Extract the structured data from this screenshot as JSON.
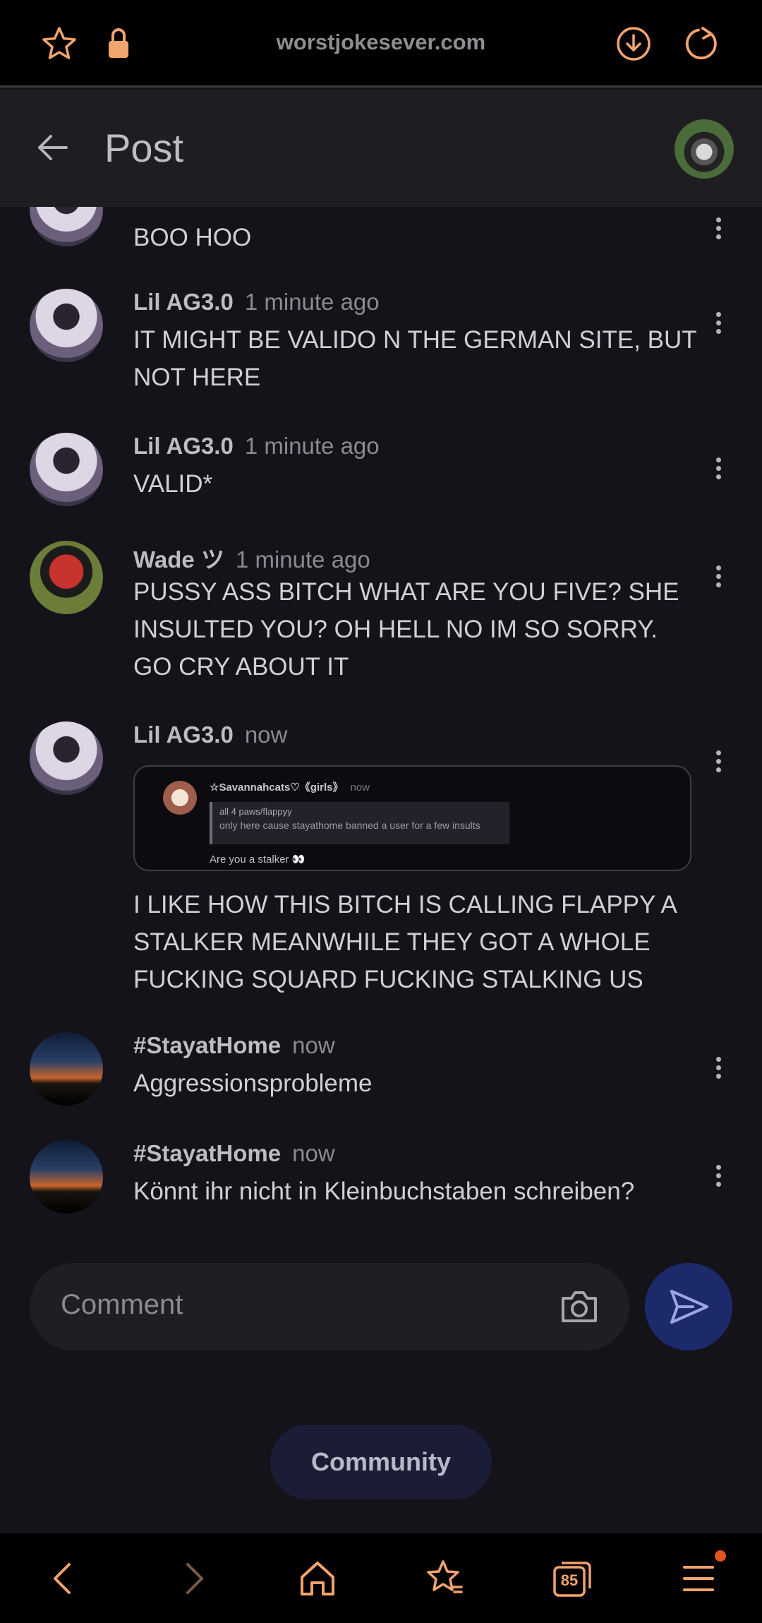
{
  "browser": {
    "url": "worstjokesever.com",
    "accent": "#f2a46d"
  },
  "header": {
    "title": "Post"
  },
  "comments": [
    {
      "author": "",
      "time": "",
      "text": "BOO HOO",
      "avatar": "lil"
    },
    {
      "author": "Lil AG3.0",
      "time": "1 minute ago",
      "text": "IT MIGHT BE VALIDO N THE GERMAN SITE, BUT NOT HERE",
      "avatar": "lil"
    },
    {
      "author": "Lil AG3.0",
      "time": "1 minute ago",
      "text": "VALID*",
      "avatar": "lil"
    },
    {
      "author": "Wade ツ",
      "time": "1 minute ago",
      "text": "PUSSY ASS BITCH WHAT ARE YOU FIVE? SHE INSULTED YOU? OH HELL NO IM SO SORRY. GO CRY ABOUT IT",
      "avatar": "wade"
    },
    {
      "author": "Lil AG3.0",
      "time": "now",
      "text": "I LIKE HOW THIS BITCH IS CALLING FLAPPY A STALKER MEANWHILE THEY GOT A WHOLE FUCKING SQUARD FUCKING STALKING US",
      "avatar": "lil",
      "embed": {
        "user": "☆Savannahcats♡《girls》",
        "time": "now",
        "quote_title": "all 4 paws/flappyy",
        "quote_text": "only here cause stayathome banned a user for a few insults",
        "message": "Are you a stalker 👀"
      }
    },
    {
      "author": "#StayatHome",
      "time": "now",
      "text": "Aggressionsprobleme",
      "avatar": "stay"
    },
    {
      "author": "#StayatHome",
      "time": "now",
      "text": "Könnt ihr nicht in Kleinbuchstaben schreiben?",
      "avatar": "stay"
    }
  ],
  "composer": {
    "placeholder": "Comment"
  },
  "community_button": "Community",
  "nav": {
    "tabs_count": "85",
    "icons": [
      "back-icon",
      "forward-icon",
      "home-icon",
      "bookmarks-icon",
      "tabs-icon",
      "menu-icon"
    ]
  }
}
